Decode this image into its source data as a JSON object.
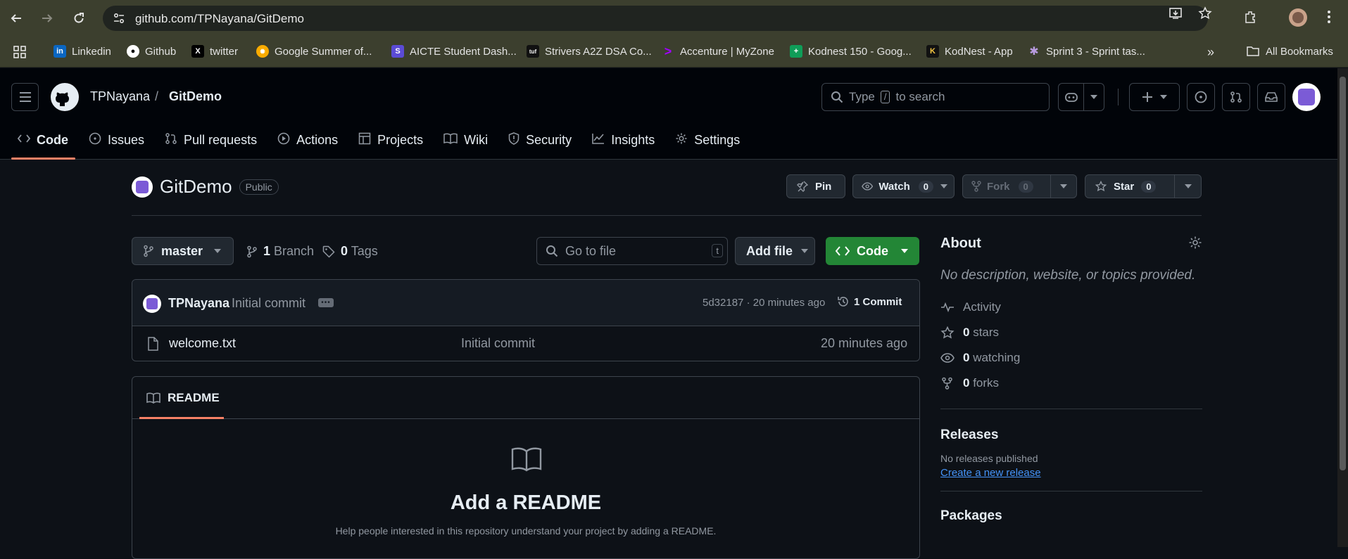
{
  "browser": {
    "url": "github.com/TPNayana/GitDemo",
    "bookmarks": [
      {
        "label": "Linkedin",
        "color": "#0a66c2",
        "glyph": "in"
      },
      {
        "label": "Github",
        "color": "#24292f",
        "glyph": "●"
      },
      {
        "label": "twitter",
        "color": "#000000",
        "glyph": "X"
      },
      {
        "label": "Google Summer of...",
        "color": "#f9ab00",
        "glyph": "✹"
      },
      {
        "label": "AICTE Student Dash...",
        "color": "#5b4bd6",
        "glyph": "S"
      },
      {
        "label": "Strivers A2Z DSA Co...",
        "color": "#111111",
        "glyph": "tuf"
      },
      {
        "label": "Accenture | MyZone",
        "color": "#a100ff",
        "glyph": ">"
      },
      {
        "label": "Kodnest 150 - Goog...",
        "color": "#0f9d58",
        "glyph": "+"
      },
      {
        "label": "KodNest - App",
        "color": "#111111",
        "glyph": "K"
      },
      {
        "label": "Sprint 3 - Sprint tas...",
        "color": "#8a6bb5",
        "glyph": "✱"
      }
    ],
    "all_bookmarks": "All Bookmarks"
  },
  "header": {
    "owner": "TPNayana",
    "separator": "/",
    "repo": "GitDemo",
    "search_prefix": "Type",
    "search_key": "/",
    "search_suffix": "to search"
  },
  "tabs": [
    {
      "label": "Code",
      "icon": "code-icon"
    },
    {
      "label": "Issues",
      "icon": "issue-icon"
    },
    {
      "label": "Pull requests",
      "icon": "pull-request-icon"
    },
    {
      "label": "Actions",
      "icon": "play-icon"
    },
    {
      "label": "Projects",
      "icon": "table-icon"
    },
    {
      "label": "Wiki",
      "icon": "book-icon"
    },
    {
      "label": "Security",
      "icon": "shield-icon"
    },
    {
      "label": "Insights",
      "icon": "graph-icon"
    },
    {
      "label": "Settings",
      "icon": "gear-icon"
    }
  ],
  "repo": {
    "name": "GitDemo",
    "visibility": "Public",
    "pin": "Pin",
    "watch": "Watch",
    "watch_count": "0",
    "fork": "Fork",
    "fork_count": "0",
    "star": "Star",
    "star_count": "0"
  },
  "toolbar": {
    "branch": "master",
    "branch_count": "1",
    "branch_label": "Branch",
    "tag_count": "0",
    "tag_label": "Tags",
    "goto_placeholder": "Go to file",
    "goto_key": "t",
    "add_file": "Add file",
    "code": "Code"
  },
  "commit": {
    "author": "TPNayana",
    "message": "Initial commit",
    "hash_time": "5d32187 · 20 minutes ago",
    "commit_count": "1 Commit"
  },
  "files": [
    {
      "name": "welcome.txt",
      "message": "Initial commit",
      "time": "20 minutes ago"
    }
  ],
  "readme": {
    "tab": "README",
    "heading": "Add a README",
    "help": "Help people interested in this repository understand your project by adding a README."
  },
  "about": {
    "title": "About",
    "description": "No description, website, or topics provided.",
    "activity": "Activity",
    "stars_count": "0",
    "stars_label": "stars",
    "watching_count": "0",
    "watching_label": "watching",
    "forks_count": "0",
    "forks_label": "forks"
  },
  "releases": {
    "title": "Releases",
    "none": "No releases published",
    "create": "Create a new release"
  },
  "packages": {
    "title": "Packages"
  }
}
